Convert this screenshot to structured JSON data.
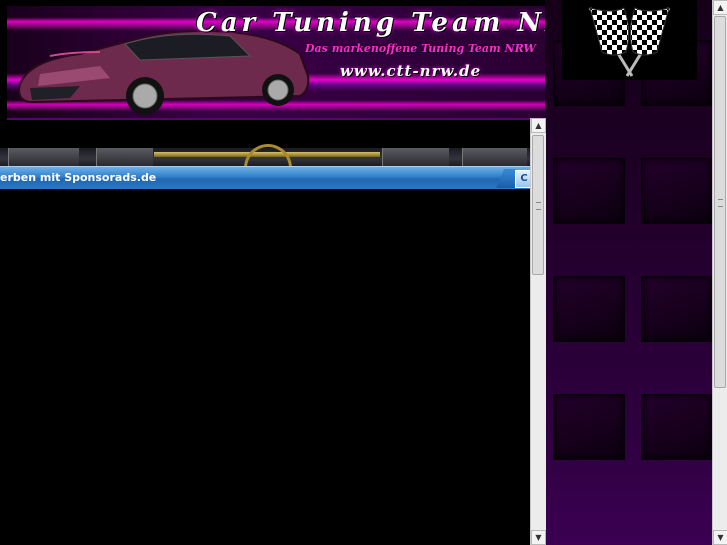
{
  "banner": {
    "title": "Car Tuning Team NRW",
    "subtitle": "Das markenoffene Tuning Team NRW",
    "url": "www.ctt-nrw.de"
  },
  "navbar": {
    "items": [
      "",
      "",
      "",
      ""
    ]
  },
  "ad_bar": {
    "text": "erben mit Sponsorads.de",
    "close_label": "C"
  },
  "scrollbars": {
    "inner": {
      "up_icon": "triangle-up-icon",
      "down_icon": "triangle-down-icon",
      "position": 0.08
    },
    "outer": {
      "up_icon": "triangle-up-icon",
      "down_icon": "triangle-down-icon",
      "position": 0.0
    }
  },
  "colors": {
    "accent_pink": "#ff2ad4",
    "ad_blue": "#2f7fc9",
    "panel_purple": "#2f0040"
  }
}
